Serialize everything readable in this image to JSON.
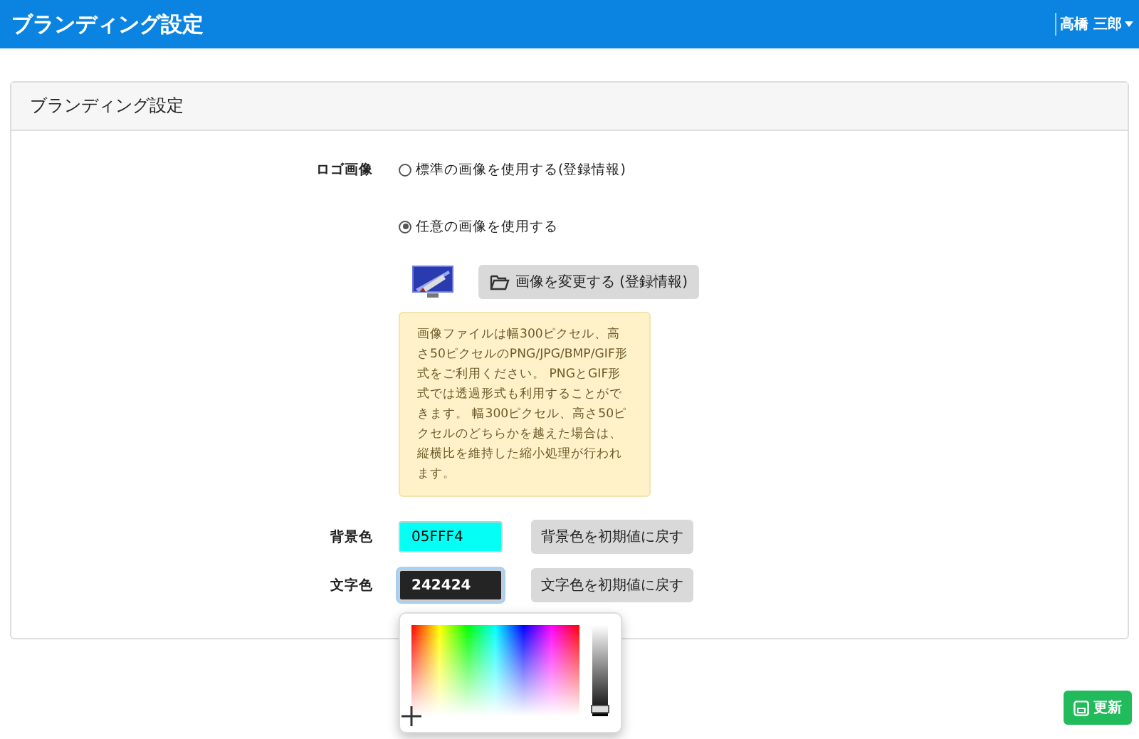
{
  "topbar": {
    "title": "ブランディング設定",
    "user": "高橋 三郎"
  },
  "panel": {
    "title": "ブランディング設定",
    "logo": {
      "label": "ロゴ画像",
      "options": [
        {
          "label": "標準の画像を使用する(登録情報)",
          "selected": false
        },
        {
          "label": "任意の画像を使用する",
          "selected": true
        }
      ],
      "change_button": "画像を変更する (登録情報)",
      "note": "画像ファイルは幅300ピクセル、高さ50ピクセルのPNG/JPG/BMP/GIF形式をご利用ください。 PNGとGIF形式では透過形式も利用することができます。 幅300ピクセル、高さ50ピクセルのどちらかを越えた場合は、縦横比を維持した縮小処理が行われます。"
    },
    "colors": [
      {
        "label": "背景色",
        "value": "05FFF4",
        "color": "#05fff4",
        "focused": false,
        "reset_button": "背景色を初期値に戻す"
      },
      {
        "label": "文字色",
        "value": "242424",
        "color": "#242424",
        "focused": true,
        "reset_button": "文字色を初期値に戻す"
      }
    ]
  },
  "picker": {
    "level": 0.08
  },
  "save_button": "更新"
}
